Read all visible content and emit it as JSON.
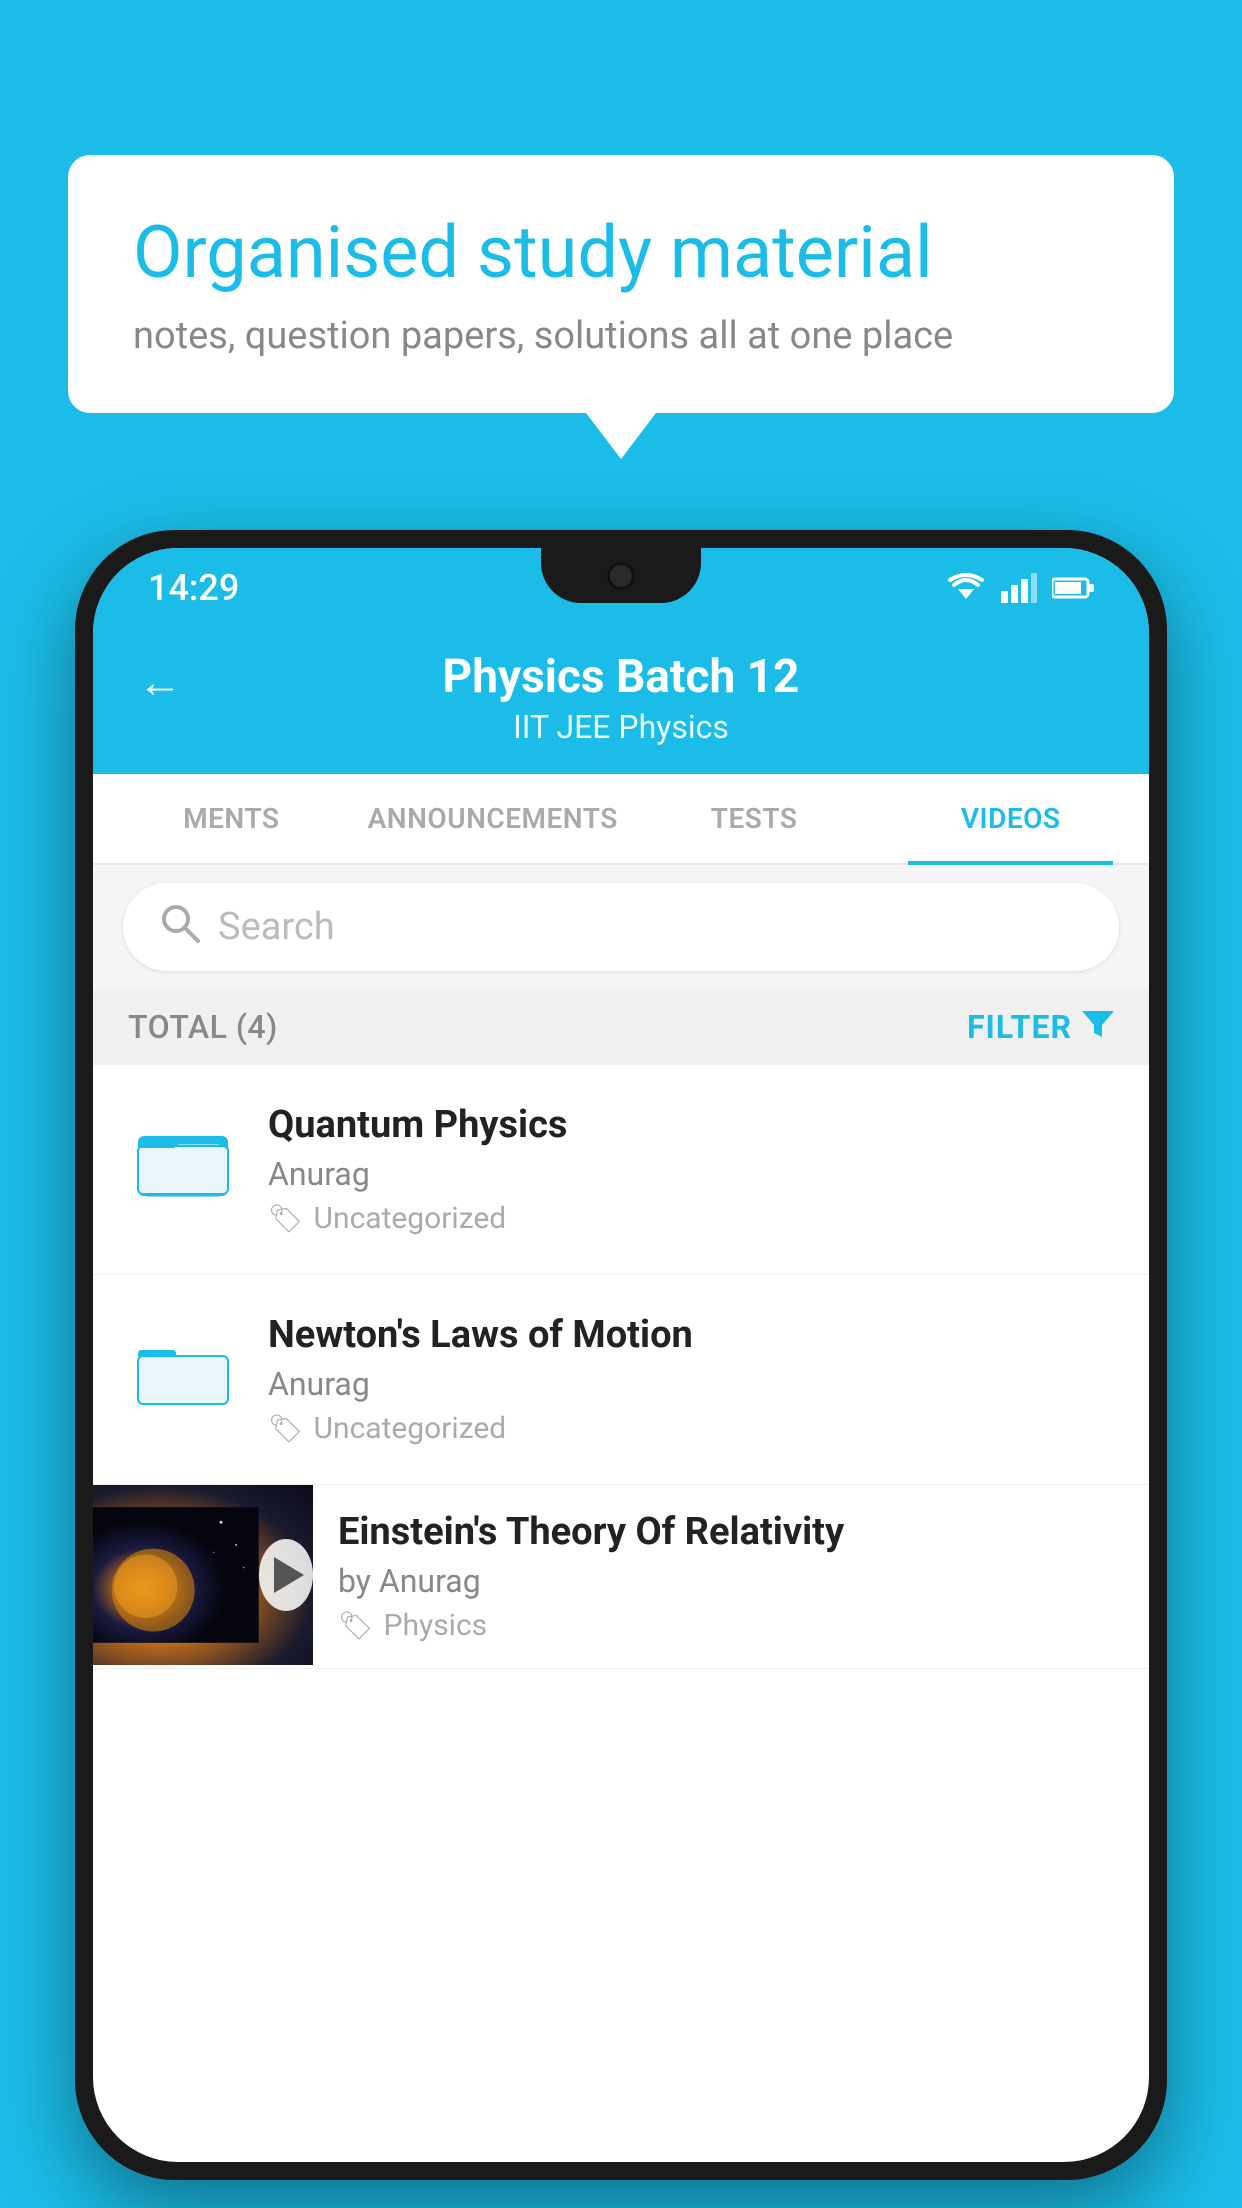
{
  "background_color": "#1bbde8",
  "bubble": {
    "title": "Organised study material",
    "subtitle": "notes, question papers, solutions all at one place"
  },
  "phone": {
    "status_bar": {
      "time": "14:29"
    },
    "header": {
      "back_label": "←",
      "title": "Physics Batch 12",
      "subtitle": "IIT JEE   Physics"
    },
    "tabs": [
      {
        "label": "MENTS",
        "active": false
      },
      {
        "label": "ANNOUNCEMENTS",
        "active": false
      },
      {
        "label": "TESTS",
        "active": false
      },
      {
        "label": "VIDEOS",
        "active": true
      }
    ],
    "search": {
      "placeholder": "Search"
    },
    "filter_bar": {
      "total_label": "TOTAL (4)",
      "filter_label": "FILTER"
    },
    "videos": [
      {
        "title": "Quantum Physics",
        "author": "Anurag",
        "tag": "Uncategorized",
        "has_thumbnail": false
      },
      {
        "title": "Newton's Laws of Motion",
        "author": "Anurag",
        "tag": "Uncategorized",
        "has_thumbnail": false
      },
      {
        "title": "Einstein's Theory Of Relativity",
        "author": "by Anurag",
        "tag": "Physics",
        "has_thumbnail": true
      }
    ]
  }
}
